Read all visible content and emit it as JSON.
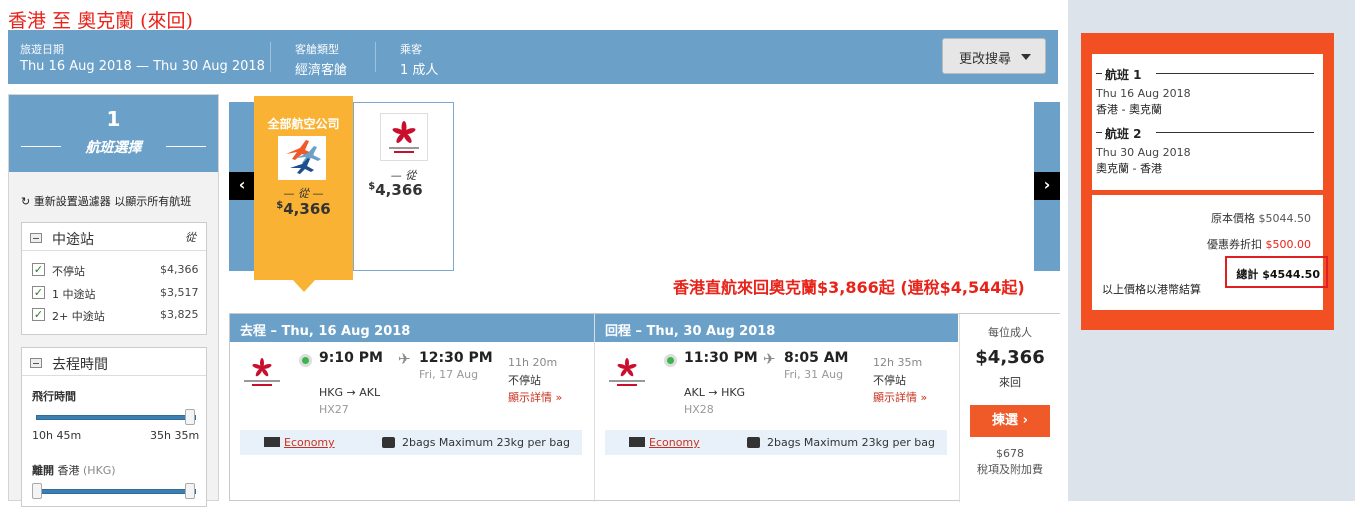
{
  "page_title": "香港 至 奧克蘭 (來回)",
  "search": {
    "date_label": "旅遊日期",
    "date_value": "Thu 16 Aug 2018 — Thu 30 Aug 2018",
    "cabin_label": "客艙類型",
    "cabin_value": "經濟客艙",
    "pax_label": "乘客",
    "pax_value": "1 成人",
    "modify_label": "更改搜尋"
  },
  "sidebar": {
    "step_number": "1",
    "step_title": "航班選擇",
    "reset_text": "重新設置過濾器 以顯示所有航班",
    "stops": {
      "title": "中途站",
      "from_icon": "從",
      "items": [
        {
          "label": "不停站",
          "price": "$4,366",
          "checked": true
        },
        {
          "label": "1 中途站",
          "price": "$3,517",
          "checked": true
        },
        {
          "label": "2+ 中途站",
          "price": "$3,825",
          "checked": true
        }
      ]
    },
    "time": {
      "title": "去程時間",
      "duration_label": "飛行時間",
      "duration_min": "10h 45m",
      "duration_max": "35h 35m",
      "depart_label": "離開",
      "depart_city": "香港",
      "depart_code": "(HKG)"
    }
  },
  "airlines": [
    {
      "name": "全部航空公司",
      "from": "從",
      "currency": "$",
      "price": "4,366",
      "selected": true
    },
    {
      "name": "HONG KONG AIRLINES 香港航空",
      "from": "從",
      "currency": "$",
      "price": "4,366",
      "selected": false
    }
  ],
  "promo": "香港直航來回奧克蘭$3,866起 (連稅$4,544起)",
  "result": {
    "outbound": {
      "header": "去程 – Thu, 16 Aug 2018",
      "dep_time": "9:10 PM",
      "arr_time": "12:30 PM",
      "arr_date": "Fri, 17 Aug",
      "route": "HKG → AKL",
      "flight": "HX27",
      "duration": "11h 20m",
      "stops": "不停站",
      "details": "顯示詳情",
      "cabin": "Economy",
      "baggage": "2bags Maximum 23kg per bag"
    },
    "inbound": {
      "header": "回程 – Thu, 30 Aug 2018",
      "dep_time": "11:30 PM",
      "arr_time": "8:05 AM",
      "arr_date": "Fri, 31 Aug",
      "route": "AKL → HKG",
      "flight": "HX28",
      "duration": "12h 35m",
      "stops": "不停站",
      "details": "顯示詳情",
      "cabin": "Economy",
      "baggage": "2bags Maximum 23kg per bag"
    },
    "price": {
      "per_adult": "每位成人",
      "amount": "$4,366",
      "trip": "來回",
      "select_label": "揀選",
      "tax": "$678",
      "tax_label": "稅項及附加費"
    }
  },
  "summary": {
    "flight1_label": "航班 1",
    "flight1_date": "Thu 16 Aug 2018",
    "flight1_route": "香港 - 奧克蘭",
    "flight2_label": "航班 2",
    "flight2_date": "Thu 30 Aug 2018",
    "flight2_route": "奧克蘭 - 香港",
    "orig_label": "原本價格",
    "orig_value": "$5044.50",
    "disc_label": "優惠券折扣",
    "disc_value": "$500.00",
    "total_label": "總計",
    "total_value": "$4544.50",
    "note": "以上價格以港幣結算"
  },
  "colors": {
    "accent": "#6ba0c9",
    "orange": "#f05a28",
    "promo": "#e8231a",
    "airline_card": "#f9b233"
  }
}
